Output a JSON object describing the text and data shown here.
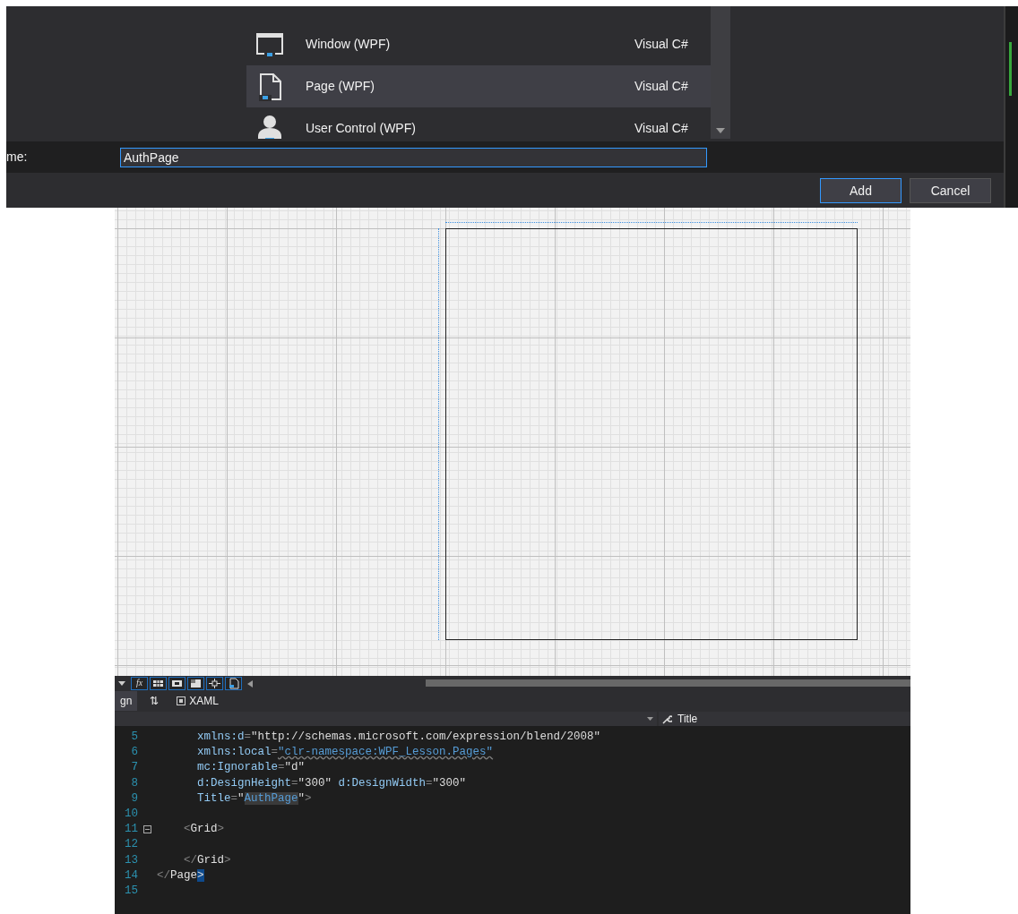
{
  "dialog": {
    "templates": [
      {
        "name": "Window (WPF)",
        "language": "Visual C#",
        "kind": "window",
        "selected": false
      },
      {
        "name": "Page (WPF)",
        "language": "Visual C#",
        "kind": "page",
        "selected": true
      },
      {
        "name": "User Control (WPF)",
        "language": "Visual C#",
        "kind": "user",
        "selected": false
      }
    ],
    "name_label": "me:",
    "name_value": "AuthPage",
    "buttons": [
      {
        "label": "Add",
        "default": true
      },
      {
        "label": "Cancel",
        "default": false
      }
    ]
  },
  "editor": {
    "formula_button": "fx",
    "tabs": [
      {
        "label": "gn",
        "kind": "text",
        "selected": true
      },
      {
        "label": "⇅",
        "kind": "text",
        "selected": false
      },
      {
        "label": "XAML",
        "kind": "xaml",
        "selected": false
      }
    ],
    "member_selector": "Title",
    "lines": [
      {
        "number": "5",
        "tokens": [
          {
            "text": "      xmlns:d",
            "kind": "attr"
          },
          {
            "text": "=",
            "kind": "punct"
          },
          {
            "text": "\"http://schemas.microsoft.com/expression/blend/2008\"",
            "kind": "string"
          }
        ]
      },
      {
        "number": "6",
        "tokens": [
          {
            "text": "      xmlns:local",
            "kind": "attr"
          },
          {
            "text": "=",
            "kind": "punct"
          },
          {
            "text": "\"clr-namespace:WPF_Lesson.Pages\"",
            "kind": "link",
            "squiggle": true
          }
        ]
      },
      {
        "number": "7",
        "tokens": [
          {
            "text": "      mc:Ignorable",
            "kind": "attr"
          },
          {
            "text": "=",
            "kind": "punct"
          },
          {
            "text": "\"d\"",
            "kind": "string"
          }
        ]
      },
      {
        "number": "8",
        "tokens": [
          {
            "text": "      d:DesignHeight",
            "kind": "attr"
          },
          {
            "text": "=",
            "kind": "punct"
          },
          {
            "text": "\"300\"",
            "kind": "string"
          },
          {
            "text": " d:DesignWidth",
            "kind": "attr"
          },
          {
            "text": "=",
            "kind": "punct"
          },
          {
            "text": "\"300\"",
            "kind": "string"
          }
        ]
      },
      {
        "number": "9",
        "tokens": [
          {
            "text": "      Title",
            "kind": "attr"
          },
          {
            "text": "=",
            "kind": "punct"
          },
          {
            "text": "\"",
            "kind": "string"
          },
          {
            "text": "AuthPage",
            "kind": "link",
            "highlighted": true
          },
          {
            "text": "\"",
            "kind": "string"
          },
          {
            "text": ">",
            "kind": "punct"
          }
        ]
      },
      {
        "number": "10"
      },
      {
        "number": "11",
        "fold": true,
        "tokens": [
          {
            "text": "    <",
            "kind": "punct"
          },
          {
            "text": "Grid",
            "kind": "tag"
          },
          {
            "text": ">",
            "kind": "punct"
          }
        ]
      },
      {
        "number": "12"
      },
      {
        "number": "13",
        "tokens": [
          {
            "text": "    </",
            "kind": "punct"
          },
          {
            "text": "Grid",
            "kind": "tag"
          },
          {
            "text": ">",
            "kind": "punct"
          }
        ]
      },
      {
        "number": "14",
        "tokens": [
          {
            "text": "</",
            "kind": "punct"
          },
          {
            "text": "Page",
            "kind": "tag"
          },
          {
            "text": ">",
            "kind": "punct",
            "brace_match": true
          }
        ]
      },
      {
        "number": "15"
      }
    ]
  }
}
